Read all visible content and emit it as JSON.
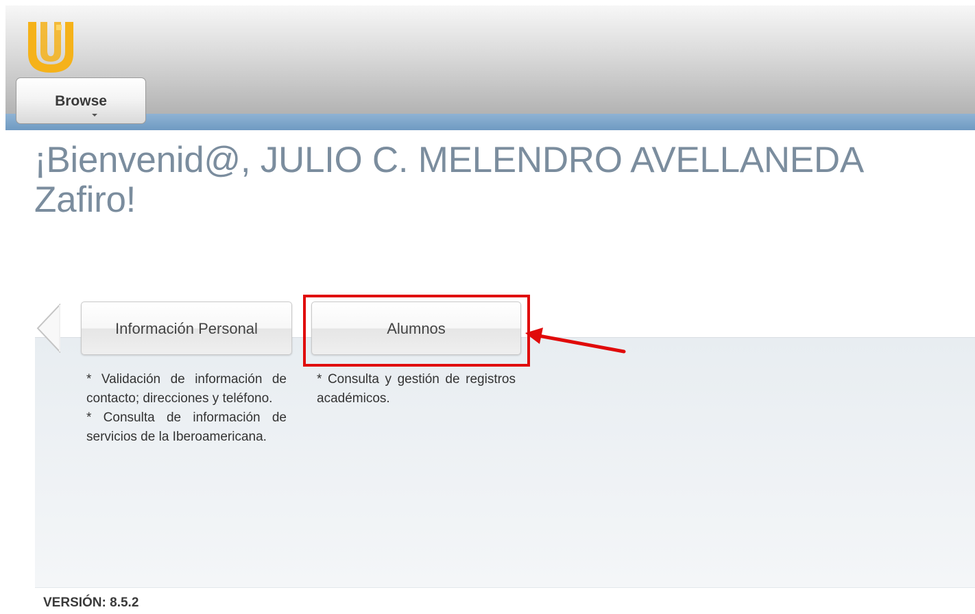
{
  "header": {
    "browse_label": "Browse",
    "brand_color": "#f5b21a",
    "accent_bar_color": "#7ba4c9"
  },
  "welcome": {
    "title": "¡Bienvenid@, JULIO C. MELENDRO AVELLANEDA",
    "title_line2": "Zafiro!"
  },
  "tiles": [
    {
      "label": "Información Personal",
      "description": [
        "* Validación de información de contacto; direcciones y teléfono.",
        "* Consulta de información de servicios de la Iberoamericana."
      ]
    },
    {
      "label": "Alumnos",
      "description": [
        "* Consulta y gestión de registros académicos."
      ]
    }
  ],
  "annotation": {
    "color": "#e00a0a"
  },
  "footer": {
    "version": "VERSIÓN: 8.5.2"
  }
}
